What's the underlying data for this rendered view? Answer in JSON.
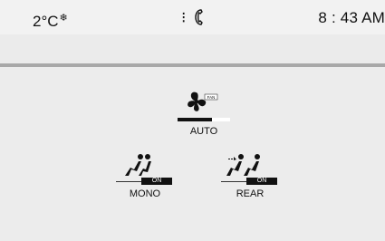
{
  "status_bar": {
    "temperature": "2°C",
    "snow_symbol": "❄",
    "phone_separator": "⁝",
    "time": "8 : 43 AM"
  },
  "climate": {
    "fan": {
      "label": "AUTO",
      "icon_badge": "FAN",
      "level_fraction": 0.66
    },
    "mono": {
      "label": "MONO",
      "state": "ON"
    },
    "rear": {
      "label": "REAR",
      "state": "ON"
    }
  },
  "icons": [
    "snowflake-icon",
    "phone-icon",
    "fan-icon",
    "seat-icon",
    "dual-seat-icon"
  ]
}
